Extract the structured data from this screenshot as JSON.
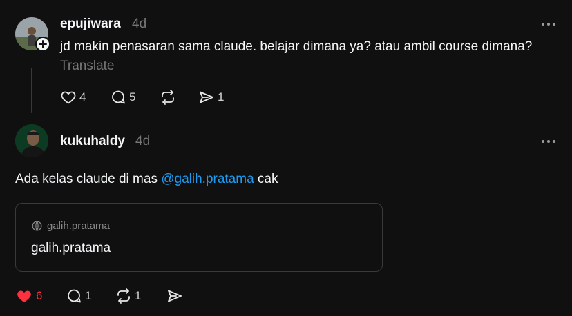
{
  "post1": {
    "username": "epujiwara",
    "time": "4d",
    "text": "jd makin penasaran sama claude. belajar dimana ya? atau ambil course dimana?",
    "translate_label": "Translate",
    "likes": "4",
    "replies": "5",
    "shares": "1"
  },
  "post2": {
    "username": "kukuhaldy",
    "time": "4d",
    "text_before": "Ada kelas claude di mas ",
    "mention": "@galih.pratama",
    "text_after": " cak",
    "card": {
      "domain": "galih.pratama",
      "title": "galih.pratama"
    },
    "likes": "6",
    "replies": "1",
    "reposts": "1"
  },
  "colors": {
    "background": "#101010",
    "mention": "#1d9bf0",
    "like_active": "#ff3040"
  }
}
